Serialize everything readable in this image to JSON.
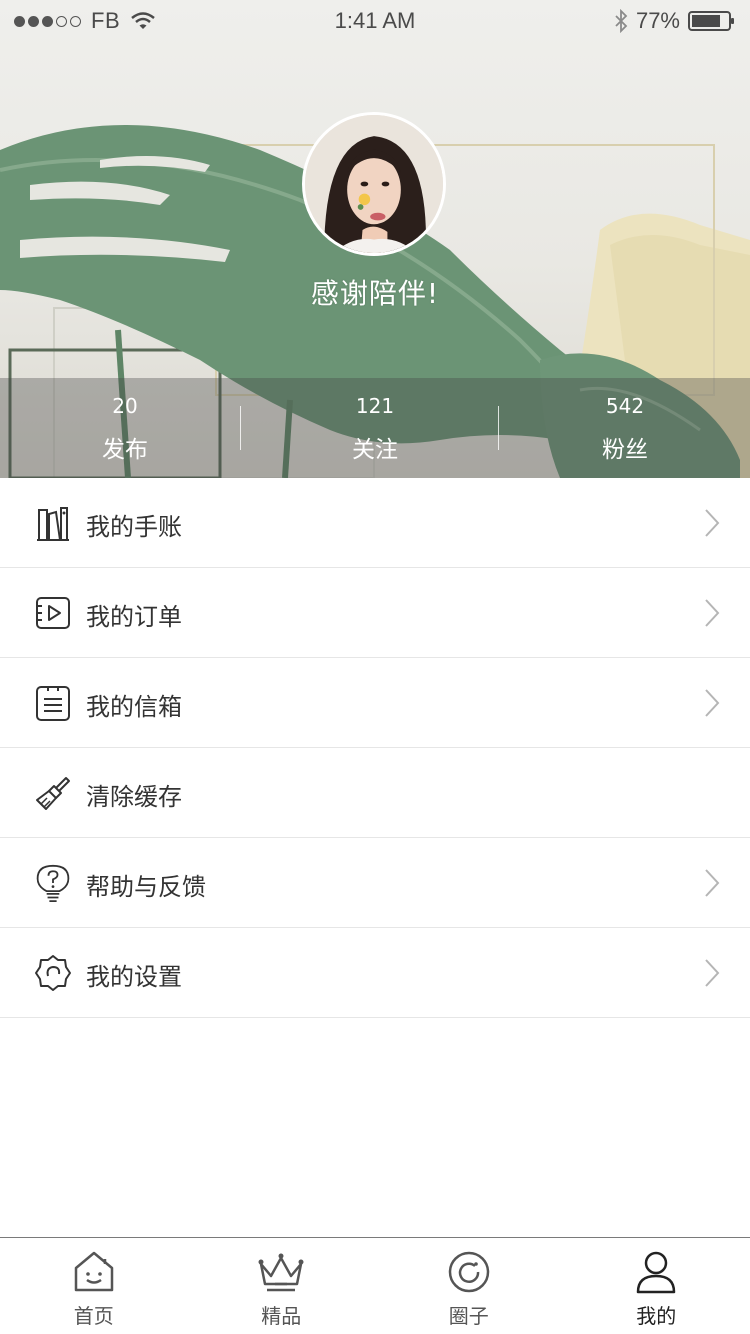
{
  "status_bar": {
    "carrier": "FB",
    "time": "1:41 AM",
    "battery": "77%",
    "battery_level": 0.77,
    "signal_bars": 3,
    "signal_total": 5
  },
  "profile": {
    "nickname": "感谢陪伴!"
  },
  "stats": [
    {
      "value": "20",
      "label": "发布"
    },
    {
      "value": "121",
      "label": "关注"
    },
    {
      "value": "542",
      "label": "粉丝"
    }
  ],
  "menu": [
    {
      "label": "我的手账",
      "icon": "notebook-icon",
      "chevron": true
    },
    {
      "label": "我的订单",
      "icon": "video-order-icon",
      "chevron": true
    },
    {
      "label": "我的信箱",
      "icon": "mailbox-icon",
      "chevron": true
    },
    {
      "label": "清除缓存",
      "icon": "brush-icon",
      "chevron": false
    },
    {
      "label": "帮助与反馈",
      "icon": "help-bulb-icon",
      "chevron": true
    },
    {
      "label": "我的设置",
      "icon": "settings-gear-icon",
      "chevron": true
    }
  ],
  "tabs": [
    {
      "label": "首页",
      "icon": "home-icon",
      "active": false
    },
    {
      "label": "精品",
      "icon": "crown-icon",
      "active": false
    },
    {
      "label": "圈子",
      "icon": "circle-icon",
      "active": false
    },
    {
      "label": "我的",
      "icon": "user-icon",
      "active": true
    }
  ],
  "colors": {
    "leaf": "#5f8a68",
    "text": "#333333",
    "divider": "#e6e6e6",
    "chevron": "#b5b5b5"
  }
}
